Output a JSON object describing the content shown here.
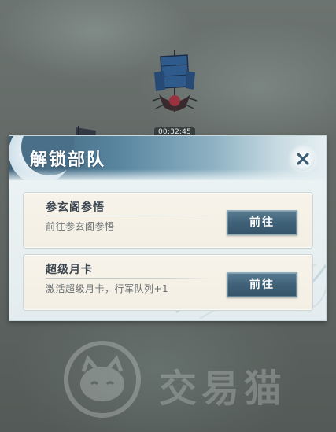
{
  "scene": {
    "timer": "00:32:45"
  },
  "dialog": {
    "title": "解锁部队",
    "cards": [
      {
        "title": "参玄阁参悟",
        "description": "前往参玄阁参悟",
        "button_label": "前往"
      },
      {
        "title": "超级月卡",
        "description": "激活超级月卡，行军队列+1",
        "button_label": "前往"
      }
    ]
  },
  "watermark": {
    "text": "交易猫"
  },
  "icons": {
    "close": "close-icon",
    "moon": "crescent-moon-icon",
    "ship": "ship-icon",
    "logo": "cat-logo-icon"
  }
}
